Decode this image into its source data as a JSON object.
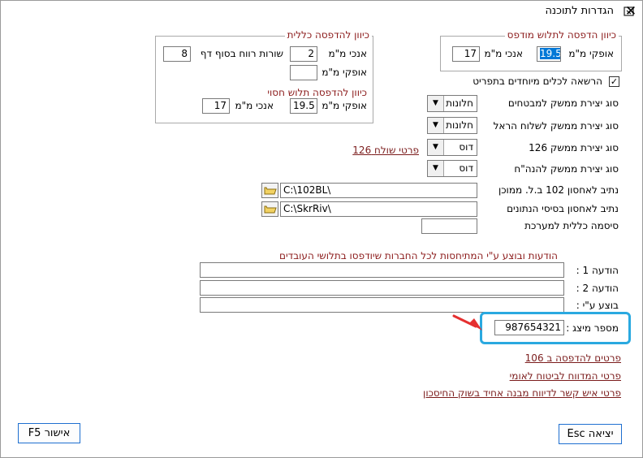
{
  "window": {
    "title": "הגדרות לתוכנה"
  },
  "group_payslip": {
    "legend": "כיוון הדפסה לתלוש מודפס",
    "horizontal_label": "אופקי מ\"מ",
    "horizontal_value": "19.5",
    "vertical_label": "אנכי מ\"מ",
    "vertical_value": "17"
  },
  "group_general": {
    "legend": "כיוון להדפסה כללית",
    "vertical_label": "אנכי מ\"מ",
    "vertical_value": "2",
    "blank_lines_label": "שורות רווח בסוף דף",
    "blank_lines_value": "8",
    "horizontal_label": "אופקי מ\"מ",
    "horizontal_value": "",
    "missing_legend": "כיוון להדפסה תלוש חסוי",
    "missing_horizontal_label": "אופקי מ\"מ",
    "missing_horizontal_value": "19.5",
    "missing_vertical_label": "אנכי מ\"מ",
    "missing_vertical_value": "17"
  },
  "special_tools": {
    "label": "הרשאה לכלים מיוחדים בתפריט",
    "checked": true
  },
  "interfaces": {
    "bakery_label": "סוג יצירת ממשק למבטחים",
    "bakery_value": "חלונות",
    "israel_label": "סוג יצירת ממשק לשלוח הראל",
    "israel_value": "חלונות",
    "i126_label": "סוג יצירת ממשק 126",
    "i126_value": "דוס",
    "hanhach_label": "סוג יצירת ממשק להנה\"ח",
    "hanhach_value": "דוס",
    "link_126": "פרטי שולח 126"
  },
  "paths": {
    "p102_label": "נתיב לאחסון 102 ב.ל. ממוכן",
    "p102_value": "C:\\102BL\\",
    "db_label": "נתיב לאחסון בסיסי הנתונים",
    "db_value": "C:\\SkrRiv\\",
    "password_label": "סיסמה כללית למערכת",
    "password_value": ""
  },
  "messages": {
    "header": "הודעות ובוצע ע\"י המתיחסות לכל החברות שיודפסו בתלושי העובדים",
    "msg1_label": "הודעה 1 :",
    "msg1_value": "",
    "msg2_label": "הודעה 2 :",
    "msg2_value": "",
    "done_by_label": "בוצע ע\"י :",
    "done_by_value": ""
  },
  "representative": {
    "label": "מספר מיצג :",
    "value": "987654321"
  },
  "links": {
    "print106": "פרטים להדפסה ב 106",
    "national_insurance": "פרטי המדווח לביטוח לאומי",
    "single_contact": "פרטי איש קשר לדיווח מבנה אחיד בשוק החיסכון"
  },
  "buttons": {
    "exit": "יציאה Esc",
    "ok": "אישור F5"
  },
  "colors": {
    "accent_highlight": "#2aa9e0",
    "link": "#7b1c1c",
    "legend": "#8b1a1a",
    "arrow": "#e53030"
  }
}
